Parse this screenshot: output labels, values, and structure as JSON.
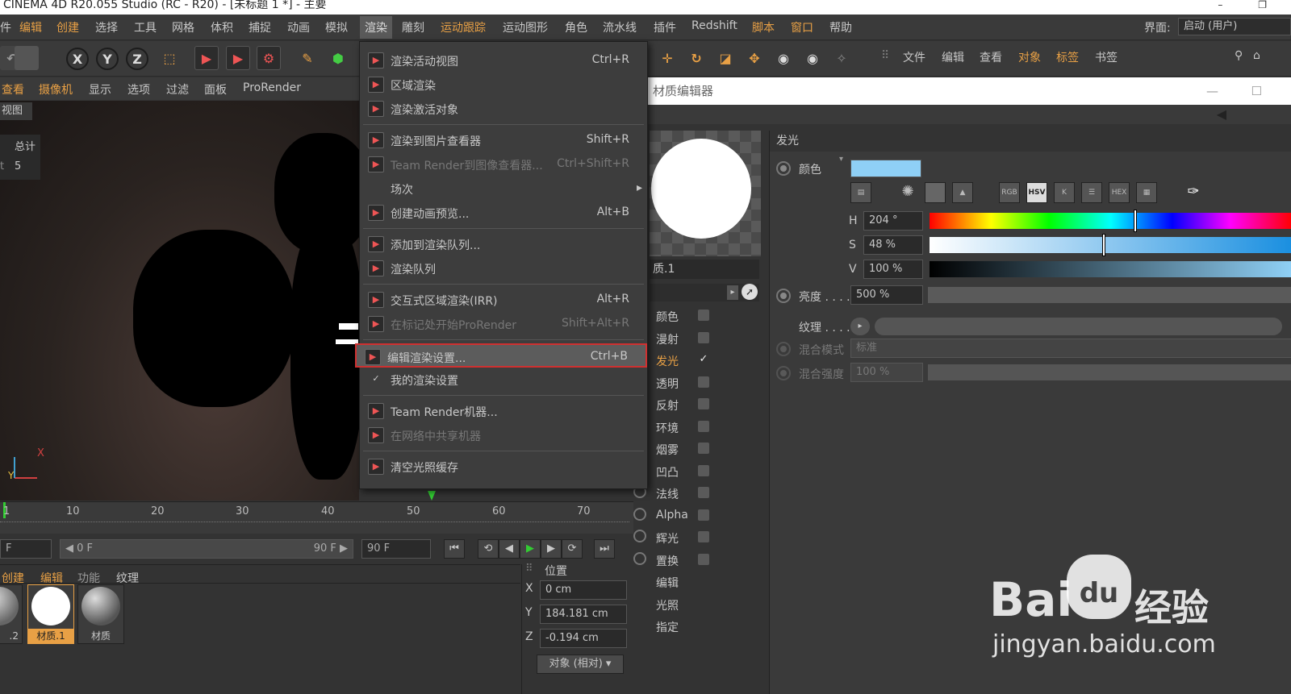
{
  "window": {
    "title": "CINEMA 4D R20.055 Studio (RC - R20) - [未标题 1 *] - 主要",
    "controls": [
      "–",
      "❐"
    ]
  },
  "menubar": {
    "items": [
      "件",
      "编辑",
      "创建",
      "选择",
      "工具",
      "网格",
      "体积",
      "捕捉",
      "动画",
      "模拟",
      "渲染",
      "雕刻",
      "运动跟踪",
      "运动图形",
      "角色",
      "流水线",
      "插件",
      "Redshift",
      "脚本",
      "窗口",
      "帮助"
    ],
    "interface_label": "界面:",
    "interface_value": "启动 (用户)"
  },
  "toolbar": {
    "axis_buttons": [
      "X",
      "Y",
      "Z"
    ],
    "right_menu": [
      "文件",
      "编辑",
      "查看",
      "对象",
      "标签",
      "书签"
    ]
  },
  "viewport": {
    "menu": [
      "查看",
      "摄像机",
      "显示",
      "选项",
      "过滤",
      "面板",
      "ProRender"
    ],
    "title": "视图",
    "stats_label": "总计",
    "stats_value": "5",
    "stats_prefix": "t",
    "axis_x": "X",
    "axis_y": "Y"
  },
  "timeline": {
    "ticks": [
      "1",
      "10",
      "20",
      "30",
      "40",
      "50",
      "60",
      "70"
    ],
    "frame_left": "F",
    "range_start": "◀ 0 F",
    "range_end": "90 F ▶",
    "end_frame": "90 F"
  },
  "material_panel": {
    "menu": [
      "创建",
      "编辑",
      "功能",
      "纹理"
    ],
    "swatches": [
      {
        "label": ".2",
        "color": "#8a8a8a"
      },
      {
        "label": "材质.1",
        "color": "#ffffff"
      },
      {
        "label": "材质",
        "color": "#8a8a8a"
      }
    ]
  },
  "coords": {
    "header": "位置",
    "rows": [
      {
        "axis": "X",
        "value": "0 cm"
      },
      {
        "axis": "Y",
        "value": "184.181 cm"
      },
      {
        "axis": "Z",
        "value": "-0.194 cm"
      }
    ],
    "mode": "对象 (相对)"
  },
  "render_menu": {
    "items": [
      {
        "label": "渲染活动视图",
        "shortcut": "Ctrl+R",
        "disabled": false
      },
      {
        "label": "区域渲染",
        "shortcut": "",
        "disabled": false
      },
      {
        "label": "渲染激活对象",
        "shortcut": "",
        "disabled": false
      },
      {
        "label": "渲染到图片查看器",
        "shortcut": "Shift+R",
        "disabled": false
      },
      {
        "label": "Team Render到图像查看器...",
        "shortcut": "Ctrl+Shift+R",
        "disabled": true
      },
      {
        "label": "场次",
        "shortcut": "",
        "disabled": false,
        "submenu": true
      },
      {
        "label": "创建动画预览...",
        "shortcut": "Alt+B",
        "disabled": false
      },
      {
        "label": "添加到渲染队列...",
        "shortcut": "",
        "disabled": false
      },
      {
        "label": "渲染队列",
        "shortcut": "",
        "disabled": false
      },
      {
        "label": "交互式区域渲染(IRR)",
        "shortcut": "Alt+R",
        "disabled": false
      },
      {
        "label": "在标记处开始ProRender",
        "shortcut": "Shift+Alt+R",
        "disabled": true
      },
      {
        "label": "编辑渲染设置...",
        "shortcut": "Ctrl+B",
        "disabled": false,
        "selected": true
      },
      {
        "label": "我的渲染设置",
        "shortcut": "",
        "disabled": false,
        "checked": true
      },
      {
        "label": "Team Render机器...",
        "shortcut": "",
        "disabled": false
      },
      {
        "label": "在网络中共享机器",
        "shortcut": "",
        "disabled": true
      },
      {
        "label": "清空光照缓存",
        "shortcut": "",
        "disabled": false
      }
    ]
  },
  "material_editor": {
    "title": "材质编辑器",
    "material_name": "质.1",
    "channels": [
      {
        "label": "颜色",
        "checked": false,
        "active": false,
        "radio": false
      },
      {
        "label": "漫射",
        "checked": false,
        "active": false,
        "radio": false
      },
      {
        "label": "发光",
        "checked": true,
        "active": true,
        "radio": false
      },
      {
        "label": "透明",
        "checked": false,
        "active": false,
        "radio": false
      },
      {
        "label": "反射",
        "checked": false,
        "active": false,
        "radio": false
      },
      {
        "label": "环境",
        "checked": false,
        "active": false,
        "radio": false
      },
      {
        "label": "烟雾",
        "checked": false,
        "active": false,
        "radio": false
      },
      {
        "label": "凹凸",
        "checked": false,
        "active": false,
        "radio": false
      },
      {
        "label": "法线",
        "checked": false,
        "active": false,
        "radio": true
      },
      {
        "label": "Alpha",
        "checked": false,
        "active": false,
        "radio": true
      },
      {
        "label": "辉光",
        "checked": false,
        "active": false,
        "radio": true
      },
      {
        "label": "置换",
        "checked": false,
        "active": false,
        "radio": true
      },
      {
        "label": "编辑",
        "checked": null,
        "active": false,
        "radio": false
      },
      {
        "label": "光照",
        "checked": null,
        "active": false,
        "radio": false
      },
      {
        "label": "指定",
        "checked": null,
        "active": false,
        "radio": false
      }
    ],
    "section": "发光",
    "color_label": "颜色",
    "color_swatch": "#8fd0f6",
    "mode_icons": [
      "RGB",
      "HSV",
      "K",
      "HEX"
    ],
    "hsv": [
      {
        "key": "H",
        "value": "204 °",
        "position": 0.567
      },
      {
        "key": "S",
        "value": "48 %",
        "position": 0.48
      },
      {
        "key": "V",
        "value": "100 %",
        "position": 1.0
      }
    ],
    "brightness_label": "亮度 . . . .",
    "brightness_value": "500 %",
    "texture_label": "纹理 . . . .",
    "blend_mode_label": "混合模式",
    "blend_mode_value": "标准",
    "blend_strength_label": "混合强度",
    "blend_strength_value": "100 %"
  },
  "watermark": {
    "brand": "Bai",
    "paw": "du",
    "suffix": "经验",
    "url": "jingyan.baidu.com"
  }
}
